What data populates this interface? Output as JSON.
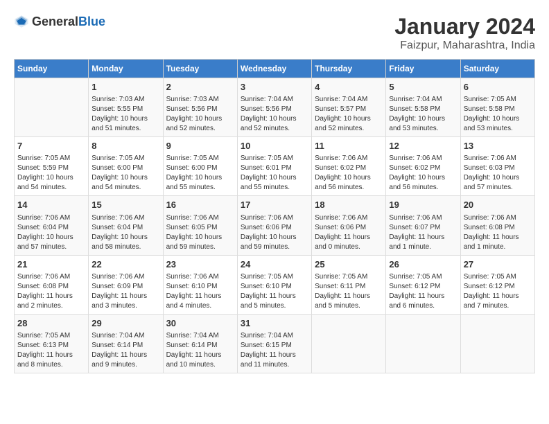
{
  "header": {
    "logo_general": "General",
    "logo_blue": "Blue",
    "title": "January 2024",
    "subtitle": "Faizpur, Maharashtra, India"
  },
  "calendar": {
    "days_of_week": [
      "Sunday",
      "Monday",
      "Tuesday",
      "Wednesday",
      "Thursday",
      "Friday",
      "Saturday"
    ],
    "weeks": [
      [
        {
          "day": "",
          "info": ""
        },
        {
          "day": "1",
          "info": "Sunrise: 7:03 AM\nSunset: 5:55 PM\nDaylight: 10 hours\nand 51 minutes."
        },
        {
          "day": "2",
          "info": "Sunrise: 7:03 AM\nSunset: 5:56 PM\nDaylight: 10 hours\nand 52 minutes."
        },
        {
          "day": "3",
          "info": "Sunrise: 7:04 AM\nSunset: 5:56 PM\nDaylight: 10 hours\nand 52 minutes."
        },
        {
          "day": "4",
          "info": "Sunrise: 7:04 AM\nSunset: 5:57 PM\nDaylight: 10 hours\nand 52 minutes."
        },
        {
          "day": "5",
          "info": "Sunrise: 7:04 AM\nSunset: 5:58 PM\nDaylight: 10 hours\nand 53 minutes."
        },
        {
          "day": "6",
          "info": "Sunrise: 7:05 AM\nSunset: 5:58 PM\nDaylight: 10 hours\nand 53 minutes."
        }
      ],
      [
        {
          "day": "7",
          "info": "Sunrise: 7:05 AM\nSunset: 5:59 PM\nDaylight: 10 hours\nand 54 minutes."
        },
        {
          "day": "8",
          "info": "Sunrise: 7:05 AM\nSunset: 6:00 PM\nDaylight: 10 hours\nand 54 minutes."
        },
        {
          "day": "9",
          "info": "Sunrise: 7:05 AM\nSunset: 6:00 PM\nDaylight: 10 hours\nand 55 minutes."
        },
        {
          "day": "10",
          "info": "Sunrise: 7:05 AM\nSunset: 6:01 PM\nDaylight: 10 hours\nand 55 minutes."
        },
        {
          "day": "11",
          "info": "Sunrise: 7:06 AM\nSunset: 6:02 PM\nDaylight: 10 hours\nand 56 minutes."
        },
        {
          "day": "12",
          "info": "Sunrise: 7:06 AM\nSunset: 6:02 PM\nDaylight: 10 hours\nand 56 minutes."
        },
        {
          "day": "13",
          "info": "Sunrise: 7:06 AM\nSunset: 6:03 PM\nDaylight: 10 hours\nand 57 minutes."
        }
      ],
      [
        {
          "day": "14",
          "info": "Sunrise: 7:06 AM\nSunset: 6:04 PM\nDaylight: 10 hours\nand 57 minutes."
        },
        {
          "day": "15",
          "info": "Sunrise: 7:06 AM\nSunset: 6:04 PM\nDaylight: 10 hours\nand 58 minutes."
        },
        {
          "day": "16",
          "info": "Sunrise: 7:06 AM\nSunset: 6:05 PM\nDaylight: 10 hours\nand 59 minutes."
        },
        {
          "day": "17",
          "info": "Sunrise: 7:06 AM\nSunset: 6:06 PM\nDaylight: 10 hours\nand 59 minutes."
        },
        {
          "day": "18",
          "info": "Sunrise: 7:06 AM\nSunset: 6:06 PM\nDaylight: 11 hours\nand 0 minutes."
        },
        {
          "day": "19",
          "info": "Sunrise: 7:06 AM\nSunset: 6:07 PM\nDaylight: 11 hours\nand 1 minute."
        },
        {
          "day": "20",
          "info": "Sunrise: 7:06 AM\nSunset: 6:08 PM\nDaylight: 11 hours\nand 1 minute."
        }
      ],
      [
        {
          "day": "21",
          "info": "Sunrise: 7:06 AM\nSunset: 6:08 PM\nDaylight: 11 hours\nand 2 minutes."
        },
        {
          "day": "22",
          "info": "Sunrise: 7:06 AM\nSunset: 6:09 PM\nDaylight: 11 hours\nand 3 minutes."
        },
        {
          "day": "23",
          "info": "Sunrise: 7:06 AM\nSunset: 6:10 PM\nDaylight: 11 hours\nand 4 minutes."
        },
        {
          "day": "24",
          "info": "Sunrise: 7:05 AM\nSunset: 6:10 PM\nDaylight: 11 hours\nand 5 minutes."
        },
        {
          "day": "25",
          "info": "Sunrise: 7:05 AM\nSunset: 6:11 PM\nDaylight: 11 hours\nand 5 minutes."
        },
        {
          "day": "26",
          "info": "Sunrise: 7:05 AM\nSunset: 6:12 PM\nDaylight: 11 hours\nand 6 minutes."
        },
        {
          "day": "27",
          "info": "Sunrise: 7:05 AM\nSunset: 6:12 PM\nDaylight: 11 hours\nand 7 minutes."
        }
      ],
      [
        {
          "day": "28",
          "info": "Sunrise: 7:05 AM\nSunset: 6:13 PM\nDaylight: 11 hours\nand 8 minutes."
        },
        {
          "day": "29",
          "info": "Sunrise: 7:04 AM\nSunset: 6:14 PM\nDaylight: 11 hours\nand 9 minutes."
        },
        {
          "day": "30",
          "info": "Sunrise: 7:04 AM\nSunset: 6:14 PM\nDaylight: 11 hours\nand 10 minutes."
        },
        {
          "day": "31",
          "info": "Sunrise: 7:04 AM\nSunset: 6:15 PM\nDaylight: 11 hours\nand 11 minutes."
        },
        {
          "day": "",
          "info": ""
        },
        {
          "day": "",
          "info": ""
        },
        {
          "day": "",
          "info": ""
        }
      ]
    ]
  }
}
